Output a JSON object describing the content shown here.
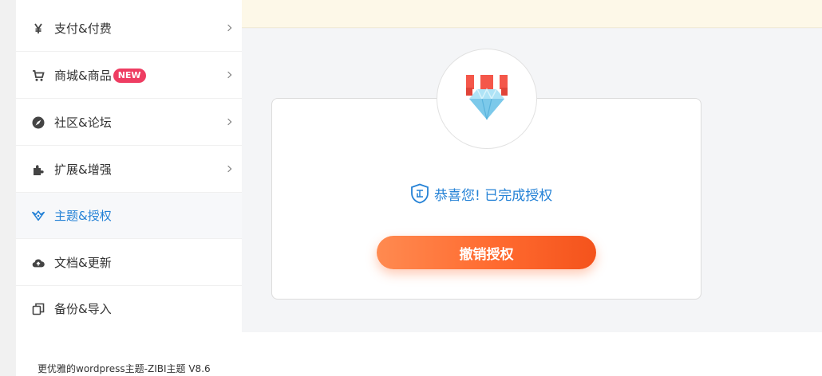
{
  "sidebar": {
    "items": [
      {
        "label": "支付&付费",
        "icon": "yen-icon"
      },
      {
        "label": "商城&商品",
        "icon": "cart-icon",
        "badge": "NEW"
      },
      {
        "label": "社区&论坛",
        "icon": "compass-icon"
      },
      {
        "label": "扩展&增强",
        "icon": "puzzle-icon"
      },
      {
        "label": "主题&授权",
        "icon": "theme-logo-icon",
        "active": true
      },
      {
        "label": "文档&更新",
        "icon": "cloud-upload-icon"
      },
      {
        "label": "备份&导入",
        "icon": "copy-icon"
      }
    ]
  },
  "license": {
    "status_text": "恭喜您! 已完成授权",
    "revoke_label": "撤销授权"
  },
  "footer": {
    "version_text": "更优雅的wordpress主题-ZIBI主题 V8.6"
  },
  "colors": {
    "accent": "#2582d6",
    "badge": "#ee3d62",
    "button_start": "#ff8a50",
    "button_end": "#f4531c",
    "banner": "#fdf8e8"
  }
}
